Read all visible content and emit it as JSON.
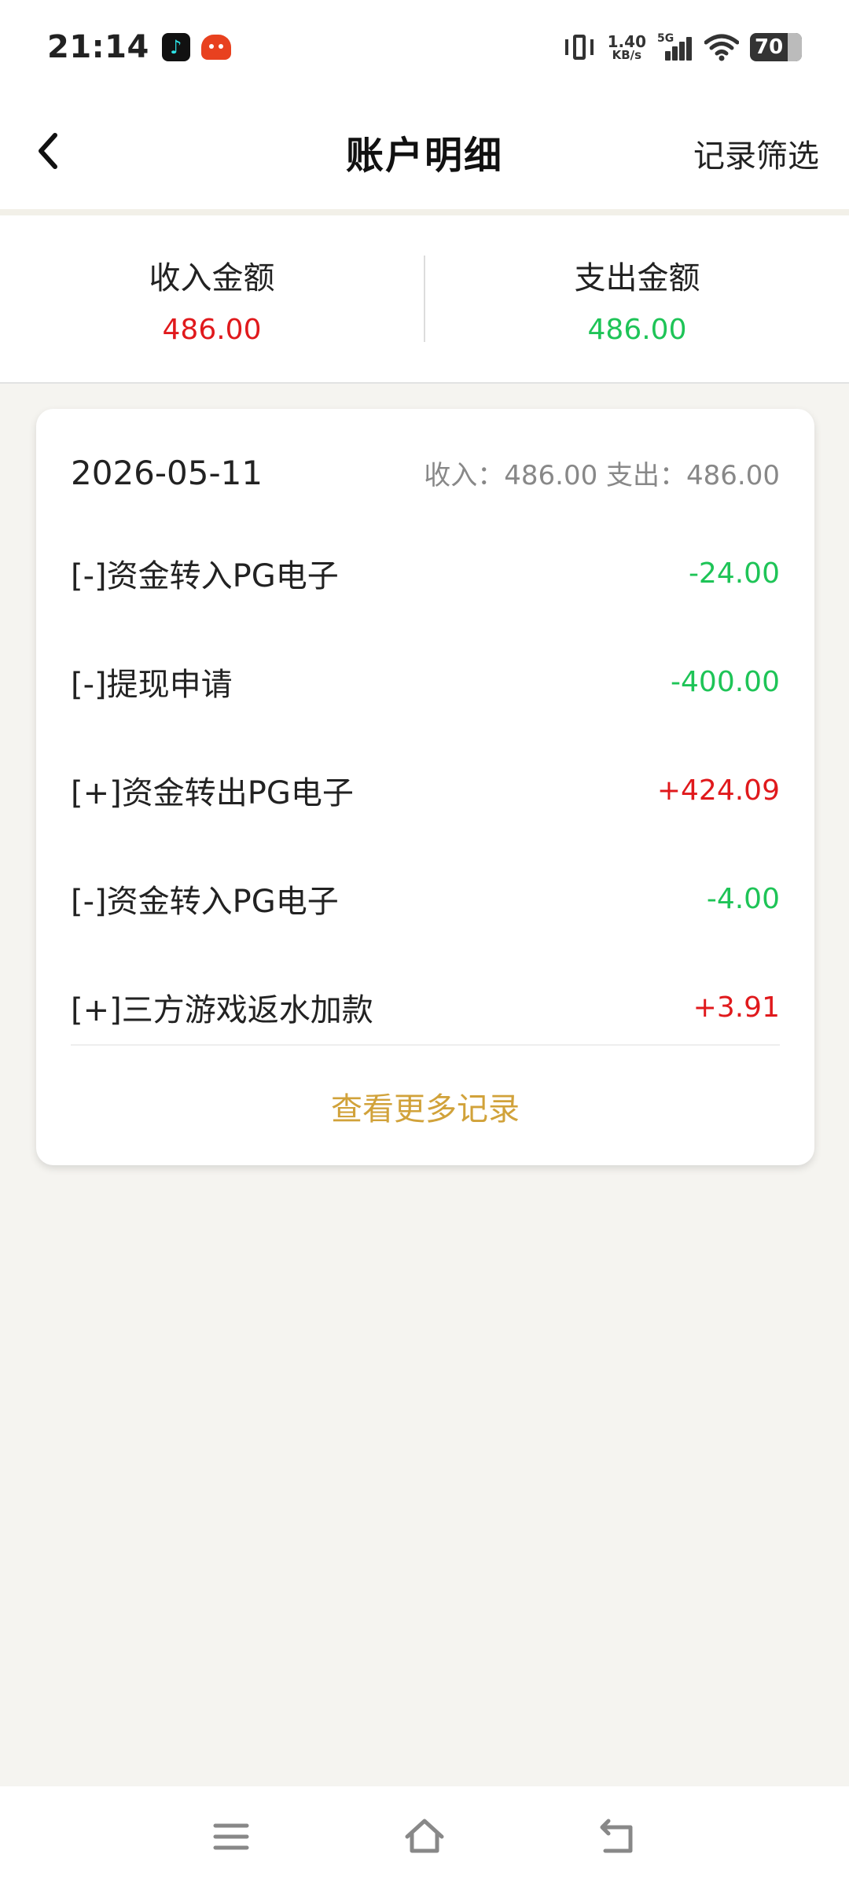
{
  "status_bar": {
    "time": "21:14",
    "net_speed_value": "1.40",
    "net_speed_unit": "KB/s",
    "network_type": "5G",
    "battery_level": "70",
    "icons": [
      "tiktok-icon",
      "game-app-icon",
      "vibrate-icon",
      "signal-icon",
      "wifi-icon",
      "battery-icon"
    ]
  },
  "nav": {
    "title": "账户明细",
    "filter_label": "记录筛选"
  },
  "summary": {
    "income_label": "收入金额",
    "income_value": "486.00",
    "expense_label": "支出金额",
    "expense_value": "486.00"
  },
  "card": {
    "date": "2026-05-11",
    "totals": "收入：486.00 支出：486.00",
    "records": [
      {
        "label": "[-]资金转入PG电子",
        "amount": "-24.00",
        "type": "expense"
      },
      {
        "label": "[-]提现申请",
        "amount": "-400.00",
        "type": "expense"
      },
      {
        "label": "[+]资金转出PG电子",
        "amount": "+424.09",
        "type": "income"
      },
      {
        "label": "[-]资金转入PG电子",
        "amount": "-4.00",
        "type": "expense"
      },
      {
        "label": "[+]三方游戏返水加款",
        "amount": "+3.91",
        "type": "income"
      }
    ],
    "more_label": "查看更多记录"
  },
  "colors": {
    "income": "#e0191c",
    "expense": "#1ec457",
    "accent": "#d1a23a"
  }
}
